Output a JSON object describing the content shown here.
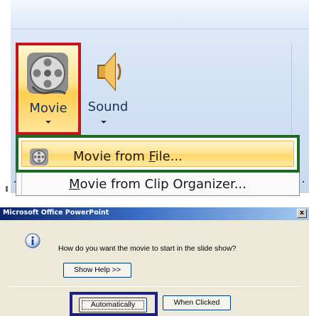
{
  "ribbon": {
    "movie_label": "Movie",
    "sound_label": "Sound",
    "movie_icon": "film-reel-icon",
    "sound_icon": "speaker-icon"
  },
  "menu": {
    "items": [
      {
        "pre": "Movie from ",
        "accel": "F",
        "post": "ile...",
        "icon": "film-reel-icon"
      },
      {
        "pre": "",
        "accel": "M",
        "post": "ovie from Clip Organizer..."
      }
    ]
  },
  "dialog": {
    "title": "Microsoft Office PowerPoint",
    "close_label": "x",
    "icon": "info-icon",
    "question": "How do you want the movie to start in the slide show?",
    "show_help": "Show Help >>",
    "automatically": "Automatically",
    "when_clicked": "When Clicked"
  },
  "colors": {
    "highlight_movie": "#c4161c",
    "highlight_menu_item": "#1d6b22",
    "highlight_auto": "#1b1f8a"
  }
}
